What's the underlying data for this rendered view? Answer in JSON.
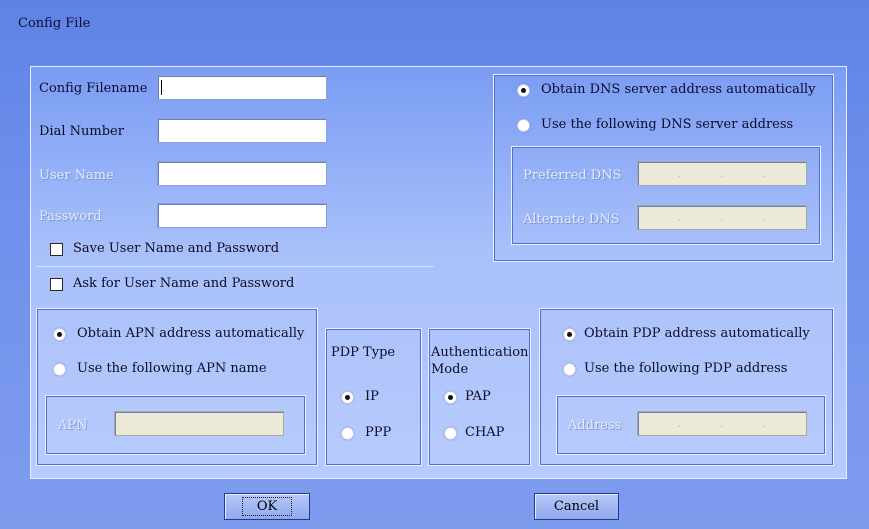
{
  "window": {
    "title": "Config File"
  },
  "profile": {
    "config_filename_label": "Config Filename",
    "config_filename_value": "",
    "dial_number_label": "Dial Number",
    "dial_number_value": "",
    "user_name_label": "User Name",
    "user_name_value": "",
    "password_label": "Password",
    "password_value": "",
    "save_credentials_label": "Save User Name and Password",
    "save_credentials_checked": false,
    "ask_credentials_label": "Ask for User Name and Password",
    "ask_credentials_checked": false
  },
  "dns": {
    "auto_label": "Obtain DNS server address automatically",
    "manual_label": "Use the following DNS server address",
    "selected": "auto",
    "preferred_label": "Preferred DNS",
    "alternate_label": "Alternate DNS",
    "ip_separator": "."
  },
  "apn": {
    "auto_label": "Obtain APN address automatically",
    "manual_label": "Use the following APN name",
    "selected": "auto",
    "apn_label": "APN",
    "apn_value": ""
  },
  "pdp_type": {
    "title": "PDP Type",
    "options": [
      "IP",
      "PPP"
    ],
    "selected": "IP"
  },
  "auth_mode": {
    "title_line1": "Authentication",
    "title_line2": "Mode",
    "options": [
      "PAP",
      "CHAP"
    ],
    "selected": "PAP"
  },
  "pdp": {
    "auto_label": "Obtain PDP address automatically",
    "manual_label": "Use the following PDP address",
    "selected": "auto",
    "address_label": "Address"
  },
  "buttons": {
    "ok_label": "OK",
    "cancel_label": "Cancel"
  },
  "colors": {
    "background": "#6e8feb",
    "panel": "#a9c0fa",
    "border": "#eaf0ff"
  }
}
